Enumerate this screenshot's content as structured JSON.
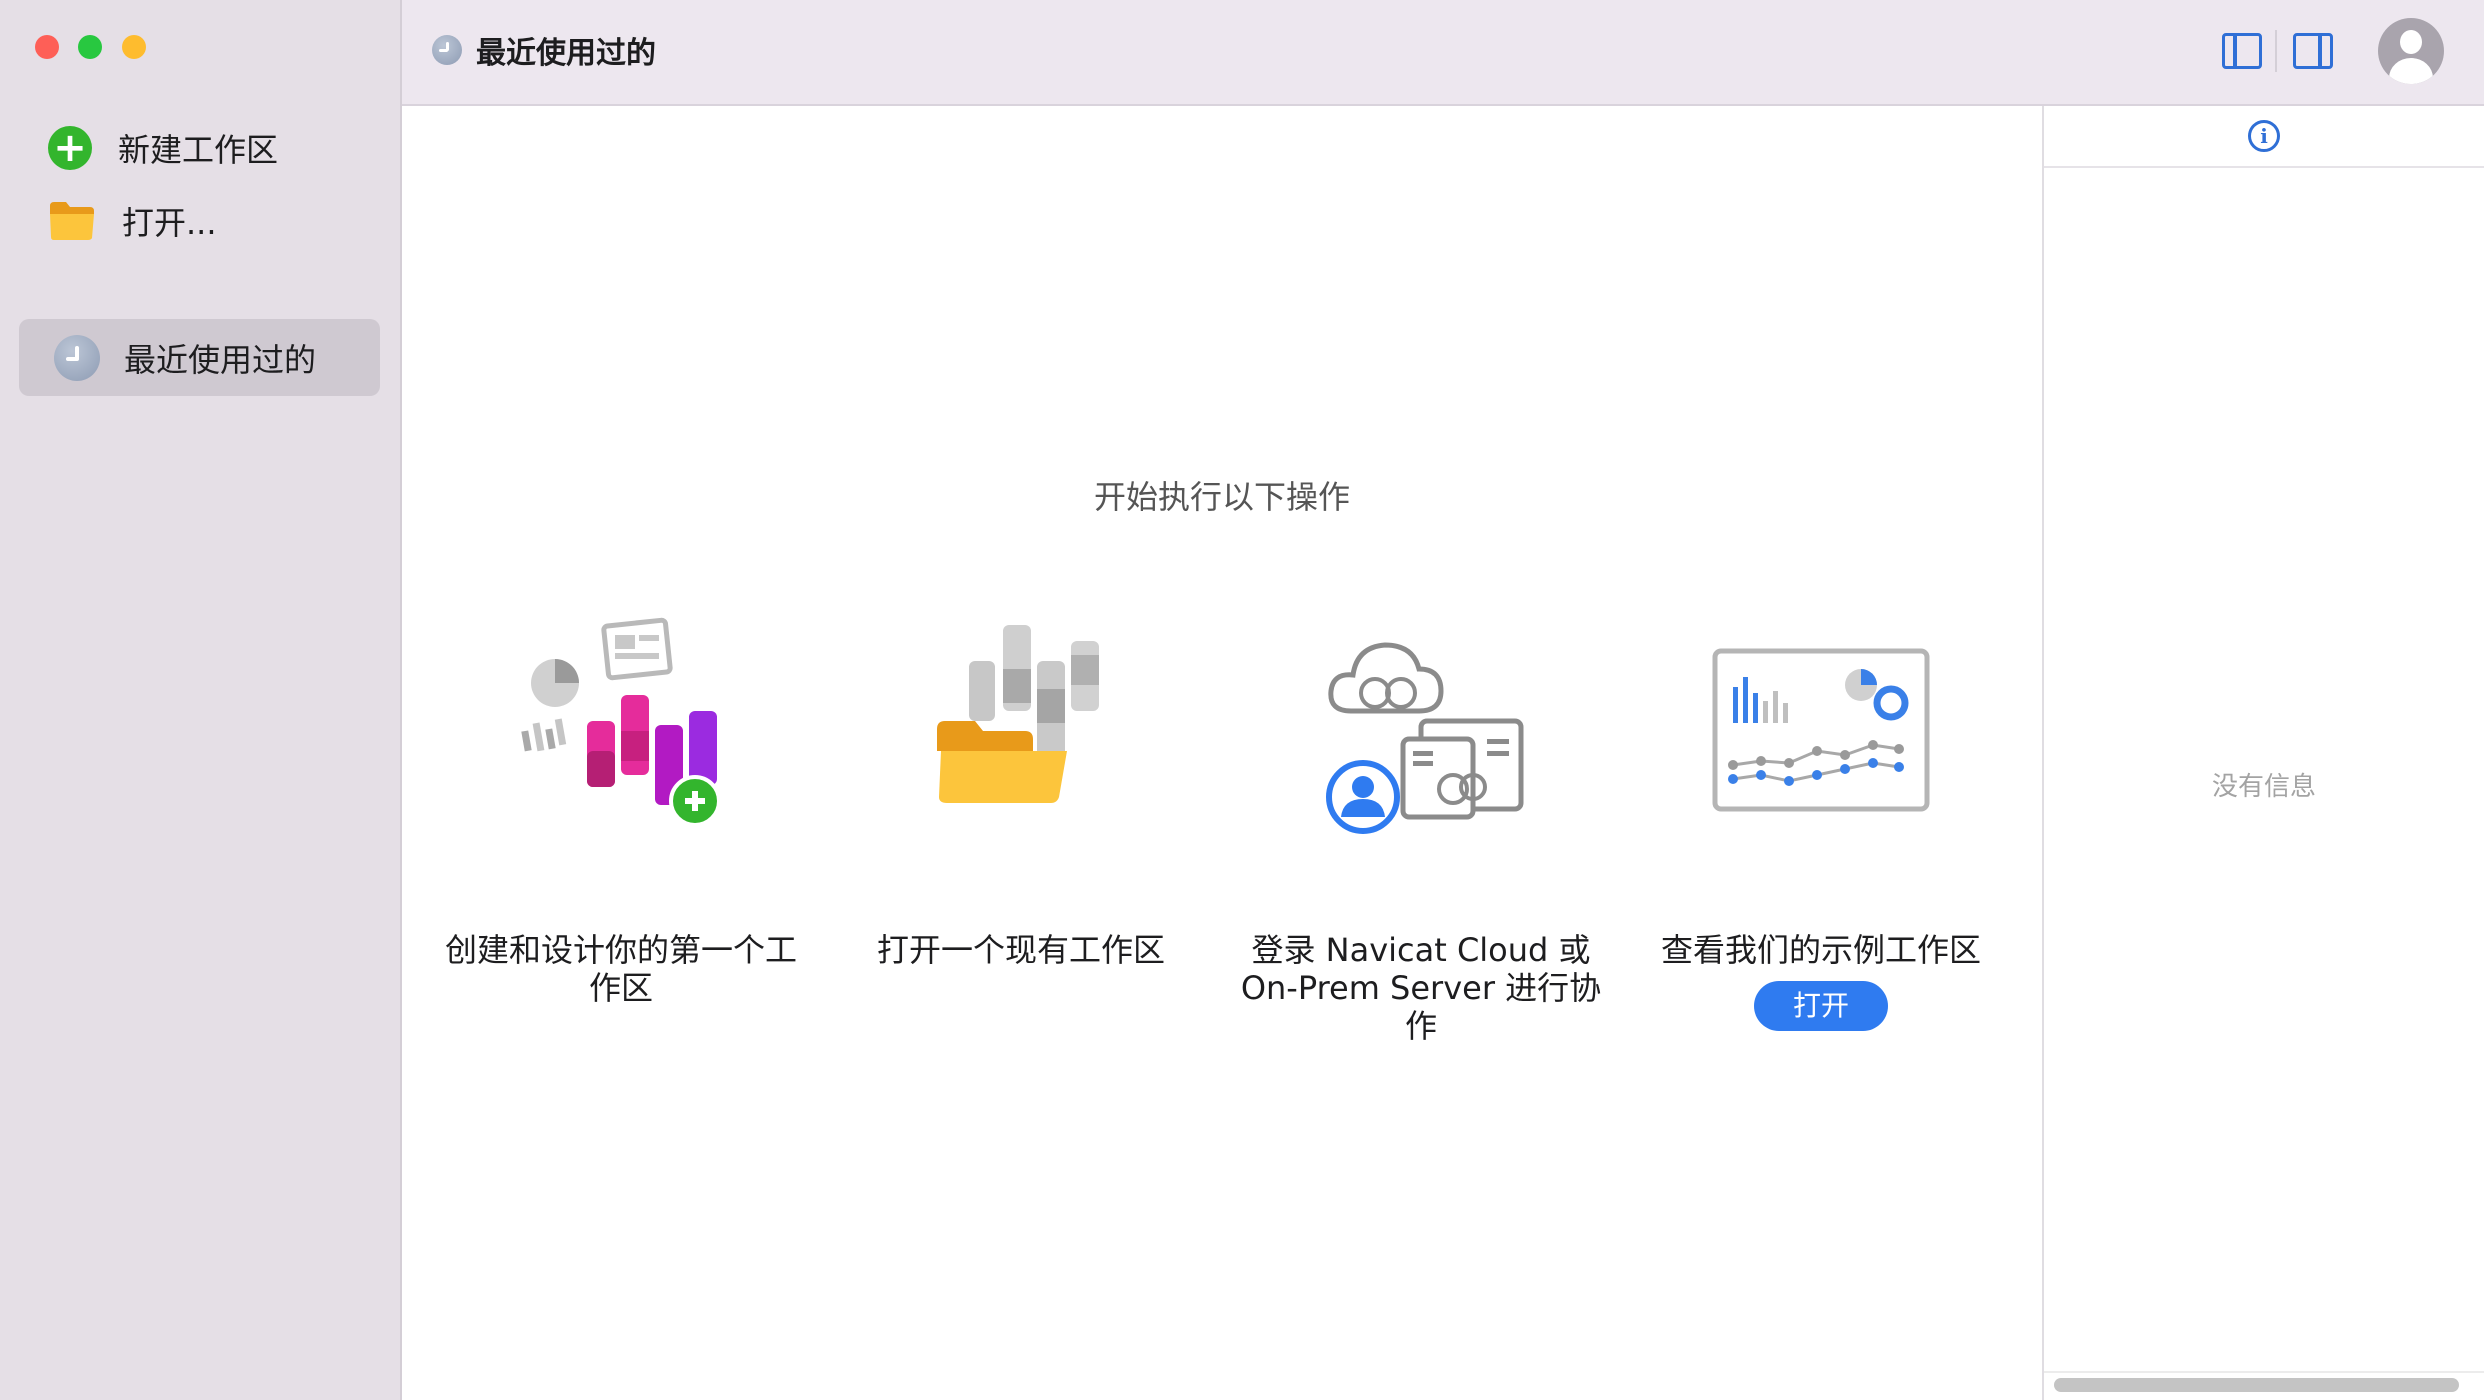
{
  "sidebar": {
    "new_workspace": "新建工作区",
    "open": "打开...",
    "recent": "最近使用过的"
  },
  "toolbar": {
    "title": "最近使用过的"
  },
  "main": {
    "heading": "开始执行以下操作",
    "cards": [
      {
        "caption": "创建和设计你的第一个工作区"
      },
      {
        "caption": "打开一个现有工作区"
      },
      {
        "caption": "登录 Navicat Cloud 或 On-Prem Server 进行协作"
      },
      {
        "caption": "查看我们的示例工作区",
        "button": "打开"
      }
    ]
  },
  "right_panel": {
    "empty_text": "没有信息"
  },
  "colors": {
    "accent": "#2f7bf0",
    "sidebar_bg": "#e5dfe6",
    "toolbar_bg": "#ede7ef",
    "add_green": "#33b52d"
  }
}
